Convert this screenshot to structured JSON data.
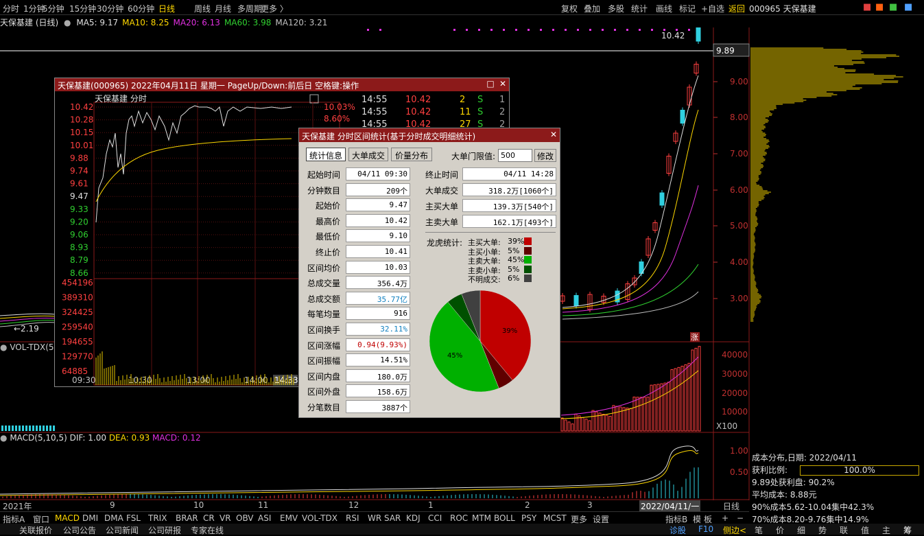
{
  "topbar": {
    "periods": [
      "分时",
      "1分钟",
      "5分钟",
      "15分钟",
      "30分钟",
      "60分钟",
      "日线",
      "周线",
      "月线",
      "多周期",
      "更多 〉"
    ],
    "active": "日线",
    "actions": [
      "复权",
      "叠加",
      "多股",
      "统计",
      "画线",
      "标记",
      "+自选",
      "返回"
    ],
    "stock_label": "000965 天保基建"
  },
  "main": {
    "title": "天保基建 (日线)",
    "ma": [
      {
        "name": "MA5: 9.17",
        "color": "#e0e0e0"
      },
      {
        "name": "MA10: 8.25",
        "color": "#ffd800"
      },
      {
        "name": "MA20: 6.13",
        "color": "#e030e0"
      },
      {
        "name": "MA60: 3.98",
        "color": "#30d030"
      },
      {
        "name": "MA120: 3.21",
        "color": "#c0c0c0"
      }
    ],
    "price_line": "9.89",
    "high_mark": "10.42",
    "low_mark": "2.19",
    "y_ticks": [
      "9.00",
      "8.00",
      "7.00",
      "6.00",
      "5.00",
      "4.00",
      "3.00"
    ],
    "vol_ticks": [
      "40000",
      "30000",
      "20000",
      "10000"
    ],
    "vol_unit": "X100",
    "macd_ticks": [
      "1.00",
      "0.50"
    ],
    "zhang_tag": "涨"
  },
  "volume": {
    "label": "VOL-TDX(5"
  },
  "macd": {
    "label": "MACD(5,10,5)",
    "dif": "DIF: 1.00",
    "dea": "DEA: 0.93",
    "macd": "MACD: 0.12"
  },
  "xaxis": {
    "labels": [
      "2021年",
      "9",
      "10",
      "11",
      "12",
      "1",
      "2",
      "3"
    ],
    "current_date": "2022/04/11/一",
    "period": "日线"
  },
  "indicator_bar": {
    "items": [
      "指标A",
      "窗口",
      "MACD",
      "DMI",
      "DMA",
      "FSL",
      "TRIX",
      "BRAR",
      "CR",
      "VR",
      "OBV",
      "ASI",
      "EMV",
      "VOL-TDX",
      "RSI",
      "WR",
      "SAR",
      "KDJ",
      "CCI",
      "ROC",
      "MTM",
      "BOLL",
      "PSY",
      "MCST",
      "更多",
      "设置"
    ],
    "active": "MACD",
    "right_items": [
      "指标B",
      "模",
      "板",
      "+",
      "−"
    ]
  },
  "bottom_bar": {
    "left": [
      "关联报价",
      "公司公告",
      "公司新闻",
      "公司研报",
      "专家在线"
    ],
    "mid": [
      "诊股",
      "F10",
      "侧边<"
    ],
    "right": [
      "笔",
      "价",
      "细",
      "势",
      "联",
      "值",
      "主",
      "筹"
    ]
  },
  "cost": {
    "title": "成本分布,日期: 2022/04/11",
    "profit_label": "获利比例:",
    "profit_value": "100.0%",
    "profit_pct": 100,
    "lines": [
      "9.89处获利盘: 90.2%",
      "平均成本: 8.88元",
      "90%成本5.62-10.04集中42.3%",
      "70%成本8.20-9.76集中14.9%"
    ]
  },
  "intraday": {
    "title": "天保基建(000965) 2022年04月11日 星期一 PageUp/Down:前后日 空格键:操作",
    "subtitle": "天保基建  分时",
    "price_ticks": [
      "10.42",
      "10.28",
      "10.15",
      "10.01",
      "9.88",
      "9.74",
      "9.61",
      "9.47",
      "9.33",
      "9.20",
      "9.06",
      "8.93",
      "8.79",
      "8.66"
    ],
    "pct_ticks": [
      "10.03%",
      "8.60%"
    ],
    "vol_ticks": [
      "454196",
      "389310",
      "324425",
      "259540",
      "194655",
      "129770",
      "64885"
    ],
    "time_ticks": [
      "09:30",
      "10:30",
      "13:00",
      "14:00"
    ],
    "cursor_time": "14:33",
    "ticks": [
      {
        "time": "14:55",
        "price": "10.42",
        "vol": "2",
        "side": "S",
        "n": "1"
      },
      {
        "time": "14:55",
        "price": "10.42",
        "vol": "11",
        "side": "S",
        "n": "2"
      },
      {
        "time": "14:55",
        "price": "10.42",
        "vol": "27",
        "side": "S",
        "n": "2"
      }
    ]
  },
  "stats": {
    "title": "天保基建 分时区间统计(基于分时成交明细统计)",
    "tabs": [
      "统计信息",
      "大单成交",
      "价量分布"
    ],
    "threshold_label": "大单门限值:",
    "threshold_value": "500",
    "modify": "修改",
    "left_rows": [
      {
        "label": "起始时间",
        "value": "04/11 09:30",
        "cls": ""
      },
      {
        "label": "分钟数目",
        "value": "209个",
        "cls": ""
      },
      {
        "label": "起始价",
        "value": "9.47",
        "cls": ""
      },
      {
        "label": "最高价",
        "value": "10.42",
        "cls": ""
      },
      {
        "label": "最低价",
        "value": "9.10",
        "cls": ""
      },
      {
        "label": "终止价",
        "value": "10.41",
        "cls": ""
      },
      {
        "label": "区间均价",
        "value": "10.03",
        "cls": ""
      },
      {
        "label": "总成交量",
        "value": "356.4万",
        "cls": ""
      },
      {
        "label": "总成交额",
        "value": "35.77亿",
        "cls": "blue"
      },
      {
        "label": "每笔均量",
        "value": "916",
        "cls": ""
      },
      {
        "label": "区间换手",
        "value": "32.11%",
        "cls": "blue"
      },
      {
        "label": "区间涨幅",
        "value": "0.94(9.93%)",
        "cls": "red"
      },
      {
        "label": "区间振幅",
        "value": "14.51%",
        "cls": ""
      },
      {
        "label": "区间内盘",
        "value": "180.0万",
        "cls": ""
      },
      {
        "label": "区间外盘",
        "value": "158.6万",
        "cls": ""
      },
      {
        "label": "分笔数目",
        "value": "3887个",
        "cls": ""
      }
    ],
    "right_rows": [
      {
        "label": "终止时间",
        "value": "04/11 14:28"
      },
      {
        "label": "大单成交",
        "value": "318.2万[1060个]"
      },
      {
        "label": "主买大单",
        "value": "139.3万[540个]"
      },
      {
        "label": "主卖大单",
        "value": "162.1万[493个]"
      }
    ],
    "dragon_label": "龙虎统计:",
    "legend": [
      {
        "label": "主买大单:",
        "pct": "39%",
        "color": "#c00000",
        "value": 39
      },
      {
        "label": "主买小单:",
        "pct": "5%",
        "color": "#600000",
        "value": 5
      },
      {
        "label": "主卖大单:",
        "pct": "45%",
        "color": "#00b000",
        "value": 45
      },
      {
        "label": "主卖小单:",
        "pct": "5%",
        "color": "#005000",
        "value": 5
      },
      {
        "label": "不明成交:",
        "pct": "6%",
        "color": "#404040",
        "value": 6
      }
    ],
    "pie_labels": [
      "39%",
      "45%"
    ]
  }
}
